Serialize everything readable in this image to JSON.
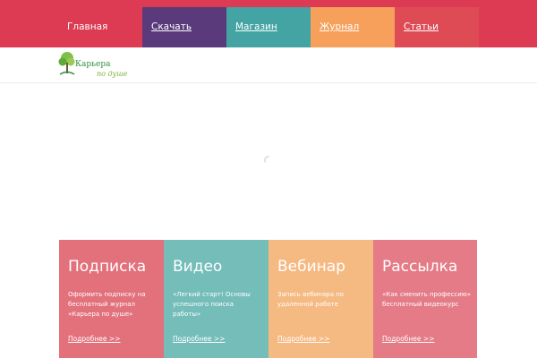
{
  "nav": {
    "items": [
      {
        "label": "Главная"
      },
      {
        "label": "Скачать"
      },
      {
        "label": "Магазин"
      },
      {
        "label": "Журнал"
      },
      {
        "label": "Статьи"
      }
    ]
  },
  "logo": {
    "main": "Карьера",
    "sub": "по душе"
  },
  "cards": [
    {
      "title": "Подписка",
      "text": "Оформить подписку на бесплатный журнал «Карьера по душе»",
      "link": "Подробнее >>"
    },
    {
      "title": "Видео",
      "text": "«Легкий старт! Основы успешного поиска работы»",
      "link": "Подробнее >>"
    },
    {
      "title": "Вебинар",
      "text": "Запись вебинара по удаленной работе",
      "link": "Подробнее >>"
    },
    {
      "title": "Рассылка",
      "text": "«Как сменить профессию» бесплатный видеокурс",
      "link": "Подробнее >>"
    }
  ],
  "colors": {
    "topbar": "#dd3a53",
    "download": "#5a3a7a",
    "shop": "#44a3a3",
    "journal": "#f6a05c",
    "articles": "#de4b55",
    "card_subscribe": "#e2717c",
    "card_video": "#74bdb9",
    "card_webinar": "#f5b982",
    "card_mailing": "#e47b86"
  }
}
